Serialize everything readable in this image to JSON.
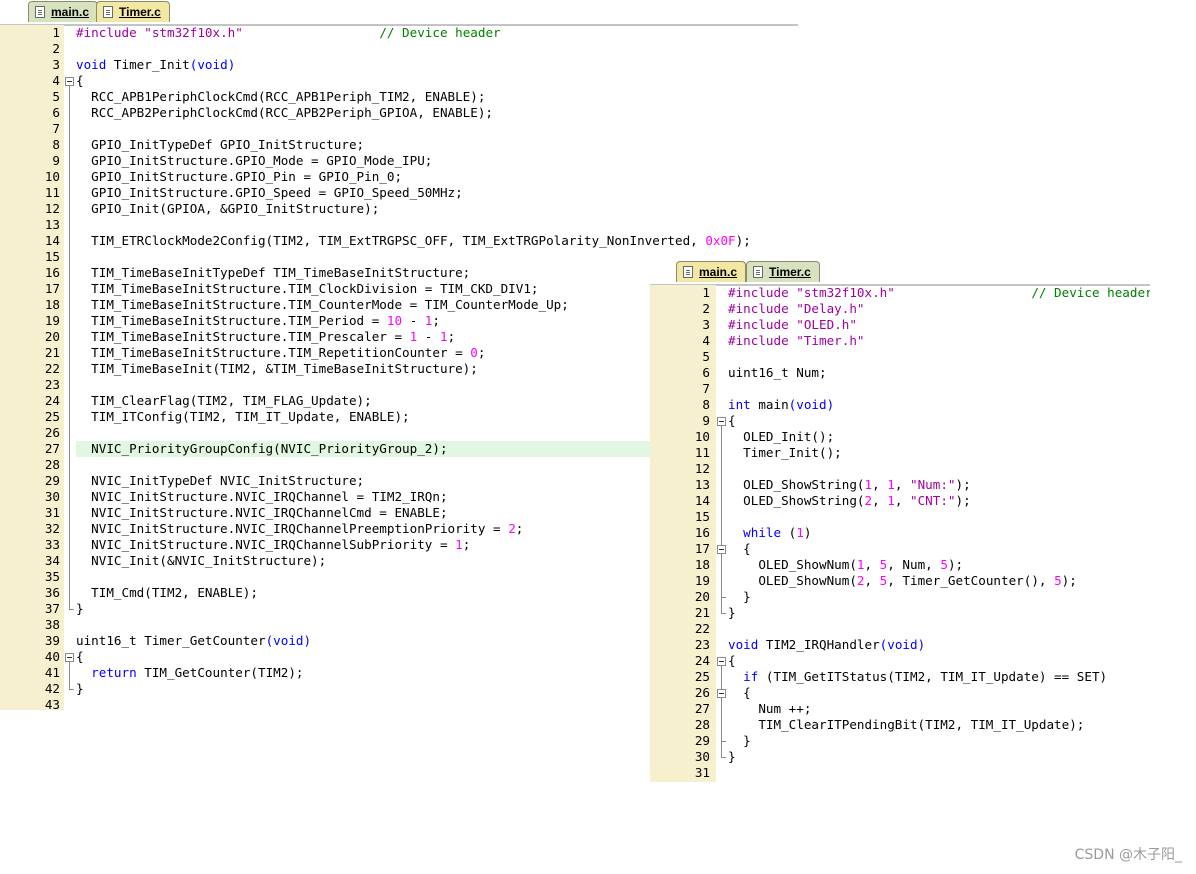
{
  "editor_timer": {
    "tabs": [
      {
        "label": "main.c",
        "active": false
      },
      {
        "label": "Timer.c",
        "active": true
      }
    ],
    "highlighted_line": 27,
    "fold_markers": [
      {
        "start": 4,
        "end": 37
      },
      {
        "start": 40,
        "end": 42
      }
    ],
    "lines": [
      [
        [
          "pp",
          "#include "
        ],
        [
          "str",
          "\"stm32f10x.h\""
        ],
        [
          "t",
          "                  "
        ],
        [
          "cm",
          "// Device header"
        ]
      ],
      [],
      [
        [
          "kw",
          "void"
        ],
        [
          "t",
          " Timer_Init"
        ],
        [
          "kw",
          "("
        ],
        [
          "kw",
          "void"
        ],
        [
          "kw",
          ")"
        ]
      ],
      [
        [
          "t",
          "{"
        ]
      ],
      [
        [
          "t",
          "  RCC_APB1PeriphClockCmd(RCC_APB1Periph_TIM2, ENABLE);"
        ]
      ],
      [
        [
          "t",
          "  RCC_APB2PeriphClockCmd(RCC_APB2Periph_GPIOA, ENABLE);"
        ]
      ],
      [],
      [
        [
          "t",
          "  GPIO_InitTypeDef GPIO_InitStructure;"
        ]
      ],
      [
        [
          "t",
          "  GPIO_InitStructure.GPIO_Mode = GPIO_Mode_IPU;"
        ]
      ],
      [
        [
          "t",
          "  GPIO_InitStructure.GPIO_Pin = GPIO_Pin_0;"
        ]
      ],
      [
        [
          "t",
          "  GPIO_InitStructure.GPIO_Speed = GPIO_Speed_50MHz;"
        ]
      ],
      [
        [
          "t",
          "  GPIO_Init(GPIOA, &GPIO_InitStructure);"
        ]
      ],
      [],
      [
        [
          "t",
          "  TIM_ETRClockMode2Config(TIM2, TIM_ExtTRGPSC_OFF, TIM_ExtTRGPolarity_NonInverted, "
        ],
        [
          "num",
          "0x0F"
        ],
        [
          "t",
          ");"
        ]
      ],
      [],
      [
        [
          "t",
          "  TIM_TimeBaseInitTypeDef TIM_TimeBaseInitStructure;"
        ]
      ],
      [
        [
          "t",
          "  TIM_TimeBaseInitStructure.TIM_ClockDivision = TIM_CKD_DIV1;"
        ]
      ],
      [
        [
          "t",
          "  TIM_TimeBaseInitStructure.TIM_CounterMode = TIM_CounterMode_Up;"
        ]
      ],
      [
        [
          "t",
          "  TIM_TimeBaseInitStructure.TIM_Period = "
        ],
        [
          "num",
          "10"
        ],
        [
          "t",
          " - "
        ],
        [
          "num",
          "1"
        ],
        [
          "t",
          ";"
        ]
      ],
      [
        [
          "t",
          "  TIM_TimeBaseInitStructure.TIM_Prescaler = "
        ],
        [
          "num",
          "1"
        ],
        [
          "t",
          " - "
        ],
        [
          "num",
          "1"
        ],
        [
          "t",
          ";"
        ]
      ],
      [
        [
          "t",
          "  TIM_TimeBaseInitStructure.TIM_RepetitionCounter = "
        ],
        [
          "num",
          "0"
        ],
        [
          "t",
          ";"
        ]
      ],
      [
        [
          "t",
          "  TIM_TimeBaseInit(TIM2, &TIM_TimeBaseInitStructure);"
        ]
      ],
      [],
      [
        [
          "t",
          "  TIM_ClearFlag(TIM2, TIM_FLAG_Update);"
        ]
      ],
      [
        [
          "t",
          "  TIM_ITConfig(TIM2, TIM_IT_Update, ENABLE);"
        ]
      ],
      [],
      [
        [
          "t",
          "  NVIC_PriorityGroupConfig(NVIC_PriorityGroup_2);"
        ]
      ],
      [],
      [
        [
          "t",
          "  NVIC_InitTypeDef NVIC_InitStructure;"
        ]
      ],
      [
        [
          "t",
          "  NVIC_InitStructure.NVIC_IRQChannel = TIM2_IRQn;"
        ]
      ],
      [
        [
          "t",
          "  NVIC_InitStructure.NVIC_IRQChannelCmd = ENABLE;"
        ]
      ],
      [
        [
          "t",
          "  NVIC_InitStructure.NVIC_IRQChannelPreemptionPriority = "
        ],
        [
          "num",
          "2"
        ],
        [
          "t",
          ";"
        ]
      ],
      [
        [
          "t",
          "  NVIC_InitStructure.NVIC_IRQChannelSubPriority = "
        ],
        [
          "num",
          "1"
        ],
        [
          "t",
          ";"
        ]
      ],
      [
        [
          "t",
          "  NVIC_Init(&NVIC_InitStructure);"
        ]
      ],
      [],
      [
        [
          "t",
          "  TIM_Cmd(TIM2, ENABLE);"
        ]
      ],
      [
        [
          "t",
          "}"
        ]
      ],
      [],
      [
        [
          "t",
          "uint16_t Timer_GetCounter"
        ],
        [
          "kw",
          "("
        ],
        [
          "kw",
          "void"
        ],
        [
          "kw",
          ")"
        ]
      ],
      [
        [
          "t",
          "{"
        ]
      ],
      [
        [
          "t",
          "  "
        ],
        [
          "kw",
          "return"
        ],
        [
          "t",
          " TIM_GetCounter(TIM2);"
        ]
      ],
      [
        [
          "t",
          "}"
        ]
      ],
      []
    ]
  },
  "editor_main": {
    "tabs": [
      {
        "label": "main.c",
        "active": true
      },
      {
        "label": "Timer.c",
        "active": false
      }
    ],
    "highlighted_line": null,
    "fold_markers": [
      {
        "start": 9,
        "end": 21
      },
      {
        "start": 17,
        "end": 20
      },
      {
        "start": 24,
        "end": 30
      },
      {
        "start": 26,
        "end": 29
      }
    ],
    "lines": [
      [
        [
          "pp",
          "#include "
        ],
        [
          "str",
          "\"stm32f10x.h\""
        ],
        [
          "t",
          "                  "
        ],
        [
          "cm",
          "// Device header"
        ]
      ],
      [
        [
          "pp",
          "#include "
        ],
        [
          "str",
          "\"Delay.h\""
        ]
      ],
      [
        [
          "pp",
          "#include "
        ],
        [
          "str",
          "\"OLED.h\""
        ]
      ],
      [
        [
          "pp",
          "#include "
        ],
        [
          "str",
          "\"Timer.h\""
        ]
      ],
      [],
      [
        [
          "t",
          "uint16_t Num;"
        ]
      ],
      [],
      [
        [
          "kw",
          "int"
        ],
        [
          "t",
          " main"
        ],
        [
          "kw",
          "("
        ],
        [
          "kw",
          "void"
        ],
        [
          "kw",
          ")"
        ]
      ],
      [
        [
          "t",
          "{"
        ]
      ],
      [
        [
          "t",
          "  OLED_Init();"
        ]
      ],
      [
        [
          "t",
          "  Timer_Init();"
        ]
      ],
      [],
      [
        [
          "t",
          "  OLED_ShowString("
        ],
        [
          "num",
          "1"
        ],
        [
          "t",
          ", "
        ],
        [
          "num",
          "1"
        ],
        [
          "t",
          ", "
        ],
        [
          "str",
          "\"Num:\""
        ],
        [
          "t",
          ");"
        ]
      ],
      [
        [
          "t",
          "  OLED_ShowString("
        ],
        [
          "num",
          "2"
        ],
        [
          "t",
          ", "
        ],
        [
          "num",
          "1"
        ],
        [
          "t",
          ", "
        ],
        [
          "str",
          "\"CNT:\""
        ],
        [
          "t",
          ");"
        ]
      ],
      [],
      [
        [
          "t",
          "  "
        ],
        [
          "kw",
          "while"
        ],
        [
          "t",
          " ("
        ],
        [
          "num",
          "1"
        ],
        [
          "t",
          ")"
        ]
      ],
      [
        [
          "t",
          "  {"
        ]
      ],
      [
        [
          "t",
          "    OLED_ShowNum("
        ],
        [
          "num",
          "1"
        ],
        [
          "t",
          ", "
        ],
        [
          "num",
          "5"
        ],
        [
          "t",
          ", Num, "
        ],
        [
          "num",
          "5"
        ],
        [
          "t",
          ");"
        ]
      ],
      [
        [
          "t",
          "    OLED_ShowNum("
        ],
        [
          "num",
          "2"
        ],
        [
          "t",
          ", "
        ],
        [
          "num",
          "5"
        ],
        [
          "t",
          ", Timer_GetCounter(), "
        ],
        [
          "num",
          "5"
        ],
        [
          "t",
          ");"
        ]
      ],
      [
        [
          "t",
          "  }"
        ]
      ],
      [
        [
          "t",
          "}"
        ]
      ],
      [],
      [
        [
          "kw",
          "void"
        ],
        [
          "t",
          " TIM2_IRQHandler"
        ],
        [
          "kw",
          "("
        ],
        [
          "kw",
          "void"
        ],
        [
          "kw",
          ")"
        ]
      ],
      [
        [
          "t",
          "{"
        ]
      ],
      [
        [
          "t",
          "  "
        ],
        [
          "kw",
          "if"
        ],
        [
          "t",
          " (TIM_GetITStatus(TIM2, TIM_IT_Update) == SET)"
        ]
      ],
      [
        [
          "t",
          "  {"
        ]
      ],
      [
        [
          "t",
          "    Num ++;"
        ]
      ],
      [
        [
          "t",
          "    TIM_ClearITPendingBit(TIM2, TIM_IT_Update);"
        ]
      ],
      [
        [
          "t",
          "  }"
        ]
      ],
      [
        [
          "t",
          "}"
        ]
      ],
      []
    ]
  },
  "watermark": "CSDN @木子阳_"
}
